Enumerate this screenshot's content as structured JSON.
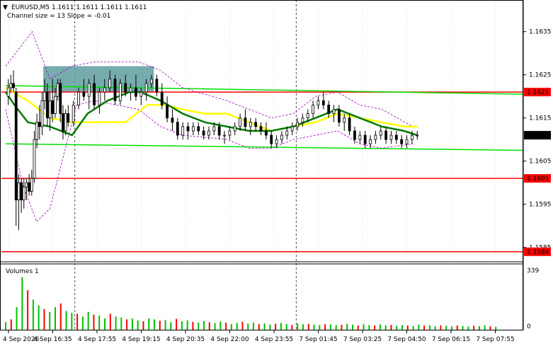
{
  "header": {
    "symbol_line": "EURUSD,M5  1.1611 1.1611 1.1611 1.1611",
    "indicator_line": "Channel size = 13 Slope = -0.01"
  },
  "volumes_panel": {
    "title": "Volumes 1",
    "top_label": "339",
    "bottom_label": "0"
  },
  "colors": {
    "level_line": "#ff0000",
    "channel_line": "#00e000",
    "ma_fast": "#007a00",
    "ma_slow": "#ffff00",
    "bollinger": "#a000c0",
    "entry_zone": "#5f9ea0",
    "volume_bars": "#00c000",
    "volume_bars_red": "#ff0000"
  },
  "chart_data": {
    "type": "candlestick",
    "symbol": "EURUSD",
    "timeframe": "M5",
    "ylim": [
      1.1582,
      1.1642
    ],
    "price_ticks": [
      "1.1635",
      "1.1625",
      "1.1615",
      "1.1605",
      "1.1595",
      "1.1585"
    ],
    "price_tick_values": [
      1.1635,
      1.1625,
      1.1615,
      1.1605,
      1.1595,
      1.1585
    ],
    "time_labels": [
      "4 Sep 2026",
      "4 Sep 16:35",
      "4 Sep 17:55",
      "4 Sep 19:15",
      "4 Sep 20:35",
      "4 Sep 22:00",
      "4 Sep 23:55",
      "7 Sep 01:45",
      "7 Sep 03:25",
      "7 Sep 04:50",
      "7 Sep 06:15",
      "7 Sep 07:55"
    ],
    "vertical_separators_at": [
      1.5,
      6.5
    ],
    "levels": [
      {
        "price": 1.1621,
        "label": "1.1621"
      },
      {
        "price": 1.1601,
        "label": "1.1601"
      },
      {
        "price": 1.1584,
        "label": "1.1584"
      }
    ],
    "current_price": {
      "price": 1.1611,
      "label": "1.1611"
    },
    "channel": {
      "upper": [
        [
          0,
          1.16225
        ],
        [
          12,
          1.16205
        ]
      ],
      "lower": [
        [
          0,
          1.1609
        ],
        [
          12,
          1.16075
        ]
      ]
    },
    "entry_zone": {
      "x": [
        0.85,
        3.35
      ],
      "y": [
        1.1621,
        1.1627
      ]
    },
    "ma_fast": [
      [
        0,
        1.1621
      ],
      [
        0.2,
        1.1618
      ],
      [
        0.5,
        1.1614
      ],
      [
        1,
        1.1613
      ],
      [
        1.5,
        1.1611
      ],
      [
        1.85,
        1.1616
      ],
      [
        2.3,
        1.1619
      ],
      [
        2.8,
        1.1621
      ],
      [
        3.05,
        1.1621
      ],
      [
        3.5,
        1.1619
      ],
      [
        4,
        1.1616
      ],
      [
        4.5,
        1.1614
      ],
      [
        5,
        1.1613
      ],
      [
        5.5,
        1.1612
      ],
      [
        6,
        1.1612
      ],
      [
        6.5,
        1.1613
      ],
      [
        7,
        1.1615
      ],
      [
        7.5,
        1.1617
      ],
      [
        8,
        1.1615
      ],
      [
        8.5,
        1.1613
      ],
      [
        9,
        1.1612
      ],
      [
        9.3,
        1.1611
      ]
    ],
    "ma_slow": [
      [
        0,
        1.1622
      ],
      [
        0.5,
        1.1619
      ],
      [
        1,
        1.1615
      ],
      [
        1.5,
        1.1614
      ],
      [
        2,
        1.1614
      ],
      [
        2.7,
        1.1614
      ],
      [
        3.2,
        1.1618
      ],
      [
        3.6,
        1.1618
      ],
      [
        4,
        1.1617
      ],
      [
        4.5,
        1.1616
      ],
      [
        5,
        1.1616
      ],
      [
        5.5,
        1.1614
      ],
      [
        6,
        1.1612
      ],
      [
        6.5,
        1.1613
      ],
      [
        7,
        1.1614
      ],
      [
        7.5,
        1.1616
      ],
      [
        8,
        1.1615
      ],
      [
        8.5,
        1.1614
      ],
      [
        9,
        1.1613
      ],
      [
        9.3,
        1.1613
      ]
    ],
    "boll_upper": [
      [
        0,
        1.1627
      ],
      [
        0.6,
        1.1635
      ],
      [
        1,
        1.1624
      ],
      [
        1.5,
        1.1627
      ],
      [
        2,
        1.1628
      ],
      [
        3,
        1.1628
      ],
      [
        3.5,
        1.1626
      ],
      [
        4,
        1.1622
      ],
      [
        5,
        1.1619
      ],
      [
        5.5,
        1.1617
      ],
      [
        6,
        1.1615
      ],
      [
        6.5,
        1.1616
      ],
      [
        7,
        1.162
      ],
      [
        7.5,
        1.1621
      ],
      [
        8,
        1.1618
      ],
      [
        8.5,
        1.1617
      ],
      [
        9.2,
        1.1613
      ]
    ],
    "boll_lower": [
      [
        0,
        1.1617
      ],
      [
        0.4,
        1.1599
      ],
      [
        0.7,
        1.1591
      ],
      [
        1,
        1.1594
      ],
      [
        1.3,
        1.1606
      ],
      [
        1.6,
        1.1618
      ],
      [
        2,
        1.1619
      ],
      [
        3,
        1.1617
      ],
      [
        3.5,
        1.1613
      ],
      [
        4,
        1.1611
      ],
      [
        5,
        1.161
      ],
      [
        5.5,
        1.1608
      ],
      [
        6,
        1.1608
      ],
      [
        6.5,
        1.161
      ],
      [
        7,
        1.1611
      ],
      [
        7.5,
        1.1612
      ],
      [
        8,
        1.1609
      ],
      [
        8.5,
        1.1608
      ],
      [
        9.2,
        1.1609
      ]
    ],
    "candles": [
      [
        0.05,
        1.162,
        1.1624,
        1.1618,
        1.1622
      ],
      [
        0.1,
        1.1622,
        1.1625,
        1.1621,
        1.1623
      ],
      [
        0.15,
        1.1623,
        1.1626,
        1.1621,
        1.1622
      ],
      [
        0.2,
        1.1621,
        1.1622,
        1.159,
        1.1596
      ],
      [
        0.25,
        1.1596,
        1.1602,
        1.1589,
        1.16
      ],
      [
        0.3,
        1.16,
        1.1601,
        1.1593,
        1.1596
      ],
      [
        0.35,
        1.1596,
        1.1601,
        1.1594,
        1.1599
      ],
      [
        0.4,
        1.1599,
        1.1601,
        1.1596,
        1.16
      ],
      [
        0.45,
        1.16,
        1.1602,
        1.1597,
        1.1598
      ],
      [
        0.5,
        1.1598,
        1.1603,
        1.1597,
        1.1601
      ],
      [
        0.55,
        1.1601,
        1.1612,
        1.16,
        1.161
      ],
      [
        0.6,
        1.161,
        1.1616,
        1.1608,
        1.1614
      ],
      [
        0.65,
        1.1614,
        1.1618,
        1.161,
        1.1613
      ],
      [
        0.7,
        1.1613,
        1.1621,
        1.1611,
        1.1619
      ],
      [
        0.75,
        1.1619,
        1.1624,
        1.1617,
        1.1621
      ],
      [
        0.8,
        1.1621,
        1.1623,
        1.1613,
        1.1615
      ],
      [
        0.85,
        1.1615,
        1.1621,
        1.1612,
        1.1619
      ],
      [
        0.9,
        1.1619,
        1.1624,
        1.1614,
        1.1616
      ],
      [
        0.95,
        1.1616,
        1.1622,
        1.1615,
        1.162
      ],
      [
        1.0,
        1.162,
        1.1624,
        1.1619,
        1.1623
      ],
      [
        1.05,
        1.1623,
        1.1624,
        1.1614,
        1.1616
      ],
      [
        1.1,
        1.1616,
        1.1618,
        1.161,
        1.1612
      ],
      [
        1.15,
        1.1612,
        1.1617,
        1.1611,
        1.1616
      ],
      [
        1.2,
        1.1616,
        1.1618,
        1.1613,
        1.1614
      ],
      [
        1.3,
        1.1614,
        1.1619,
        1.1613,
        1.1618
      ],
      [
        1.4,
        1.1618,
        1.1622,
        1.1617,
        1.1621
      ],
      [
        1.5,
        1.1621,
        1.1624,
        1.1619,
        1.162
      ],
      [
        1.6,
        1.162,
        1.1624,
        1.1617,
        1.1623
      ],
      [
        1.7,
        1.1623,
        1.1625,
        1.1617,
        1.1618
      ],
      [
        1.8,
        1.1618,
        1.1622,
        1.1616,
        1.1621
      ],
      [
        1.9,
        1.1621,
        1.1624,
        1.1619,
        1.1622
      ],
      [
        2.0,
        1.1622,
        1.1626,
        1.1621,
        1.1624
      ],
      [
        2.1,
        1.1624,
        1.1625,
        1.1618,
        1.1619
      ],
      [
        2.2,
        1.1619,
        1.1624,
        1.1618,
        1.1623
      ],
      [
        2.3,
        1.1623,
        1.1625,
        1.162,
        1.1621
      ],
      [
        2.4,
        1.1621,
        1.1623,
        1.1619,
        1.1622
      ],
      [
        2.5,
        1.1622,
        1.1625,
        1.1619,
        1.162
      ],
      [
        2.6,
        1.162,
        1.1622,
        1.1618,
        1.1621
      ],
      [
        2.7,
        1.1621,
        1.1624,
        1.1619,
        1.1623
      ],
      [
        2.8,
        1.1623,
        1.1625,
        1.1622,
        1.1624
      ],
      [
        2.9,
        1.1624,
        1.1625,
        1.162,
        1.1621
      ],
      [
        3.0,
        1.1621,
        1.1623,
        1.1617,
        1.1618
      ],
      [
        3.1,
        1.1618,
        1.162,
        1.1614,
        1.1615
      ],
      [
        3.2,
        1.1615,
        1.1617,
        1.1612,
        1.1614
      ],
      [
        3.3,
        1.1614,
        1.1615,
        1.161,
        1.1611
      ],
      [
        3.4,
        1.1611,
        1.1614,
        1.161,
        1.1613
      ],
      [
        3.5,
        1.1613,
        1.1614,
        1.161,
        1.1612
      ],
      [
        3.6,
        1.1612,
        1.1614,
        1.1611,
        1.1613
      ],
      [
        3.7,
        1.1613,
        1.1614,
        1.1611,
        1.1612
      ],
      [
        3.8,
        1.1612,
        1.1613,
        1.161,
        1.1611
      ],
      [
        3.9,
        1.1611,
        1.1613,
        1.161,
        1.1612
      ],
      [
        4.0,
        1.1612,
        1.1614,
        1.1611,
        1.1613
      ],
      [
        4.1,
        1.1613,
        1.1614,
        1.161,
        1.1611
      ],
      [
        4.2,
        1.1611,
        1.1612,
        1.1609,
        1.1611
      ],
      [
        4.3,
        1.1611,
        1.1613,
        1.161,
        1.1612
      ],
      [
        4.4,
        1.1612,
        1.1614,
        1.1611,
        1.1613
      ],
      [
        4.5,
        1.1613,
        1.1616,
        1.1612,
        1.1615
      ],
      [
        4.6,
        1.1615,
        1.1617,
        1.1612,
        1.1613
      ],
      [
        4.7,
        1.1613,
        1.1615,
        1.1611,
        1.1614
      ],
      [
        4.8,
        1.1614,
        1.1615,
        1.1612,
        1.1613
      ],
      [
        4.9,
        1.1613,
        1.1614,
        1.1611,
        1.1612
      ],
      [
        5.0,
        1.1612,
        1.1614,
        1.161,
        1.1611
      ],
      [
        5.1,
        1.1611,
        1.1612,
        1.1608,
        1.1609
      ],
      [
        5.2,
        1.1609,
        1.1611,
        1.1608,
        1.161
      ],
      [
        5.3,
        1.161,
        1.1612,
        1.1609,
        1.1611
      ],
      [
        5.4,
        1.1611,
        1.1613,
        1.161,
        1.1612
      ],
      [
        5.5,
        1.1612,
        1.1614,
        1.1611,
        1.1613
      ],
      [
        5.6,
        1.1613,
        1.1615,
        1.1612,
        1.1614
      ],
      [
        5.7,
        1.1614,
        1.1616,
        1.1613,
        1.1615
      ],
      [
        5.8,
        1.1615,
        1.1617,
        1.1614,
        1.1616
      ],
      [
        5.9,
        1.1616,
        1.1619,
        1.1615,
        1.1618
      ],
      [
        6.0,
        1.1618,
        1.162,
        1.1617,
        1.1619
      ],
      [
        6.1,
        1.1619,
        1.1621,
        1.1617,
        1.1618
      ],
      [
        6.2,
        1.1618,
        1.1619,
        1.1615,
        1.1616
      ],
      [
        6.3,
        1.1616,
        1.1618,
        1.1614,
        1.1617
      ],
      [
        6.4,
        1.1617,
        1.1618,
        1.1613,
        1.1614
      ],
      [
        6.5,
        1.1614,
        1.1616,
        1.1612,
        1.1615
      ],
      [
        6.6,
        1.1615,
        1.1616,
        1.1611,
        1.1612
      ],
      [
        6.7,
        1.1612,
        1.1613,
        1.1609,
        1.161
      ],
      [
        6.8,
        1.161,
        1.1612,
        1.1609,
        1.1611
      ],
      [
        6.9,
        1.1611,
        1.1612,
        1.1608,
        1.1609
      ],
      [
        7.0,
        1.1609,
        1.1611,
        1.1608,
        1.161
      ],
      [
        7.1,
        1.161,
        1.1612,
        1.1609,
        1.1611
      ],
      [
        7.2,
        1.1611,
        1.1613,
        1.161,
        1.1612
      ],
      [
        7.3,
        1.1612,
        1.1613,
        1.1609,
        1.161
      ],
      [
        7.4,
        1.161,
        1.1612,
        1.1609,
        1.1611
      ],
      [
        7.5,
        1.1611,
        1.1612,
        1.1609,
        1.161
      ],
      [
        7.6,
        1.161,
        1.1611,
        1.1608,
        1.1609
      ],
      [
        7.7,
        1.1609,
        1.1611,
        1.1608,
        1.161
      ],
      [
        7.8,
        1.161,
        1.1612,
        1.1609,
        1.1611
      ],
      [
        7.9,
        1.1611,
        1.1612,
        1.161,
        1.1611
      ]
    ],
    "volumes": [
      40,
      55,
      120,
      280,
      210,
      160,
      130,
      110,
      95,
      120,
      140,
      100,
      90,
      85,
      70,
      95,
      80,
      75,
      60,
      85,
      70,
      65,
      55,
      60,
      50,
      45,
      60,
      55,
      48,
      52,
      40,
      58,
      45,
      50,
      42,
      38,
      46,
      40,
      35,
      44,
      38,
      30,
      36,
      42,
      33,
      38,
      30,
      34,
      28,
      32,
      36,
      30,
      26,
      34,
      29,
      31,
      27,
      25,
      30,
      28,
      24,
      26,
      31,
      27,
      23,
      29,
      25,
      22,
      28,
      24,
      26,
      21,
      25,
      23,
      20,
      27,
      22,
      24,
      19,
      23,
      21,
      18,
      22,
      20,
      17,
      21,
      19,
      24,
      18,
      16
    ]
  }
}
